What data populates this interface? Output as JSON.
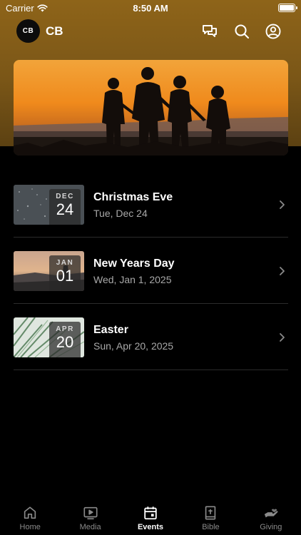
{
  "status_bar": {
    "carrier": "Carrier",
    "time": "8:50 AM"
  },
  "header": {
    "logo_text": "CB",
    "org_name": "CB",
    "icons": [
      "chat-icon",
      "search-icon",
      "account-icon"
    ]
  },
  "theme": {
    "accent": "#8e6419",
    "background": "#000000",
    "secondary_text": "#a8a8a8"
  },
  "events": [
    {
      "month": "DEC",
      "day": "24",
      "title": "Christmas Eve",
      "date": "Tue, Dec 24"
    },
    {
      "month": "JAN",
      "day": "01",
      "title": "New Years Day",
      "date": "Wed, Jan 1, 2025"
    },
    {
      "month": "APR",
      "day": "20",
      "title": "Easter",
      "date": "Sun, Apr 20, 2025"
    }
  ],
  "tabs": [
    {
      "label": "Home",
      "icon": "home-icon",
      "active": false
    },
    {
      "label": "Media",
      "icon": "media-icon",
      "active": false
    },
    {
      "label": "Events",
      "icon": "calendar-icon",
      "active": true
    },
    {
      "label": "Bible",
      "icon": "bible-icon",
      "active": false
    },
    {
      "label": "Giving",
      "icon": "giving-icon",
      "active": false
    }
  ]
}
